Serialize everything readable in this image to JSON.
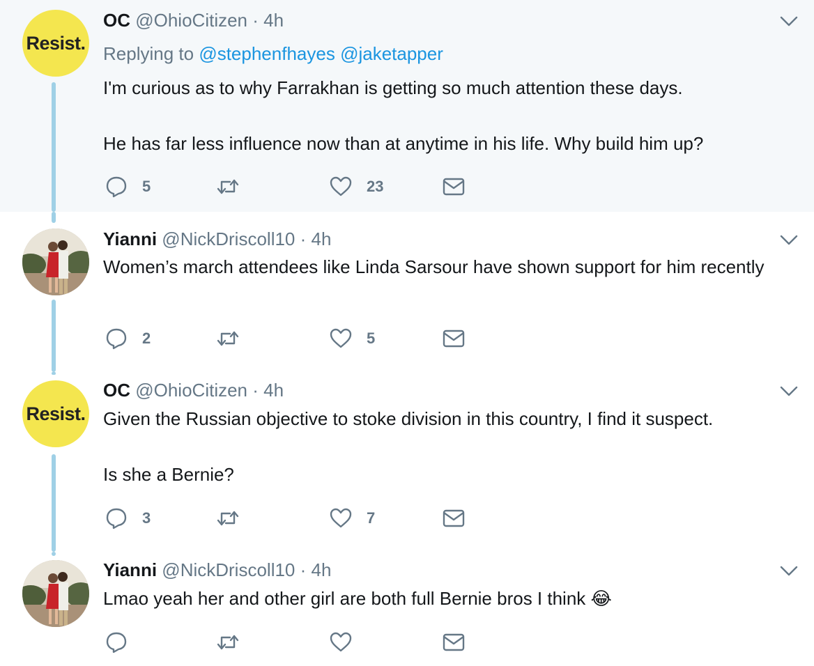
{
  "tweets": [
    {
      "avatar": "resist-avatar",
      "avatar_text": "Resist.",
      "name": "OC",
      "handle": "@OhioCitizen",
      "time": "4h",
      "replying_prefix": "Replying to",
      "replying_handles": [
        "@stephenfhayes",
        "@jaketapper"
      ],
      "paragraphs": [
        "I'm curious as to why Farrakhan is getting so much attention these days.",
        "He has far less influence now than at anytime in his life. Why build him up?"
      ],
      "replies": "5",
      "retweets": "",
      "likes": "23"
    },
    {
      "avatar": "photo-avatar",
      "name": "Yianni",
      "handle": "@NickDriscoll10",
      "time": "4h",
      "paragraphs": [
        "Women’s march attendees like Linda Sarsour have shown support for him recently"
      ],
      "replies": "2",
      "retweets": "",
      "likes": "5"
    },
    {
      "avatar": "resist-avatar",
      "avatar_text": "Resist.",
      "name": "OC",
      "handle": "@OhioCitizen",
      "time": "4h",
      "paragraphs": [
        "Given the Russian objective to stoke division in this country, I find it suspect.",
        "Is she a Bernie?"
      ],
      "replies": "3",
      "retweets": "",
      "likes": "7"
    },
    {
      "avatar": "photo-avatar",
      "name": "Yianni",
      "handle": "@NickDriscoll10",
      "time": "4h",
      "paragraphs": [
        "Lmao yeah her and other girl are both full Bernie bros I think 😂"
      ],
      "replies": "",
      "retweets": "",
      "likes": ""
    }
  ],
  "separator": "·",
  "colors": {
    "highlight_bg": "#f5f8fa",
    "thread_line": "#9fd0e6",
    "link": "#1b95e0",
    "muted": "#657786",
    "resist_yellow": "#f4e64f"
  }
}
